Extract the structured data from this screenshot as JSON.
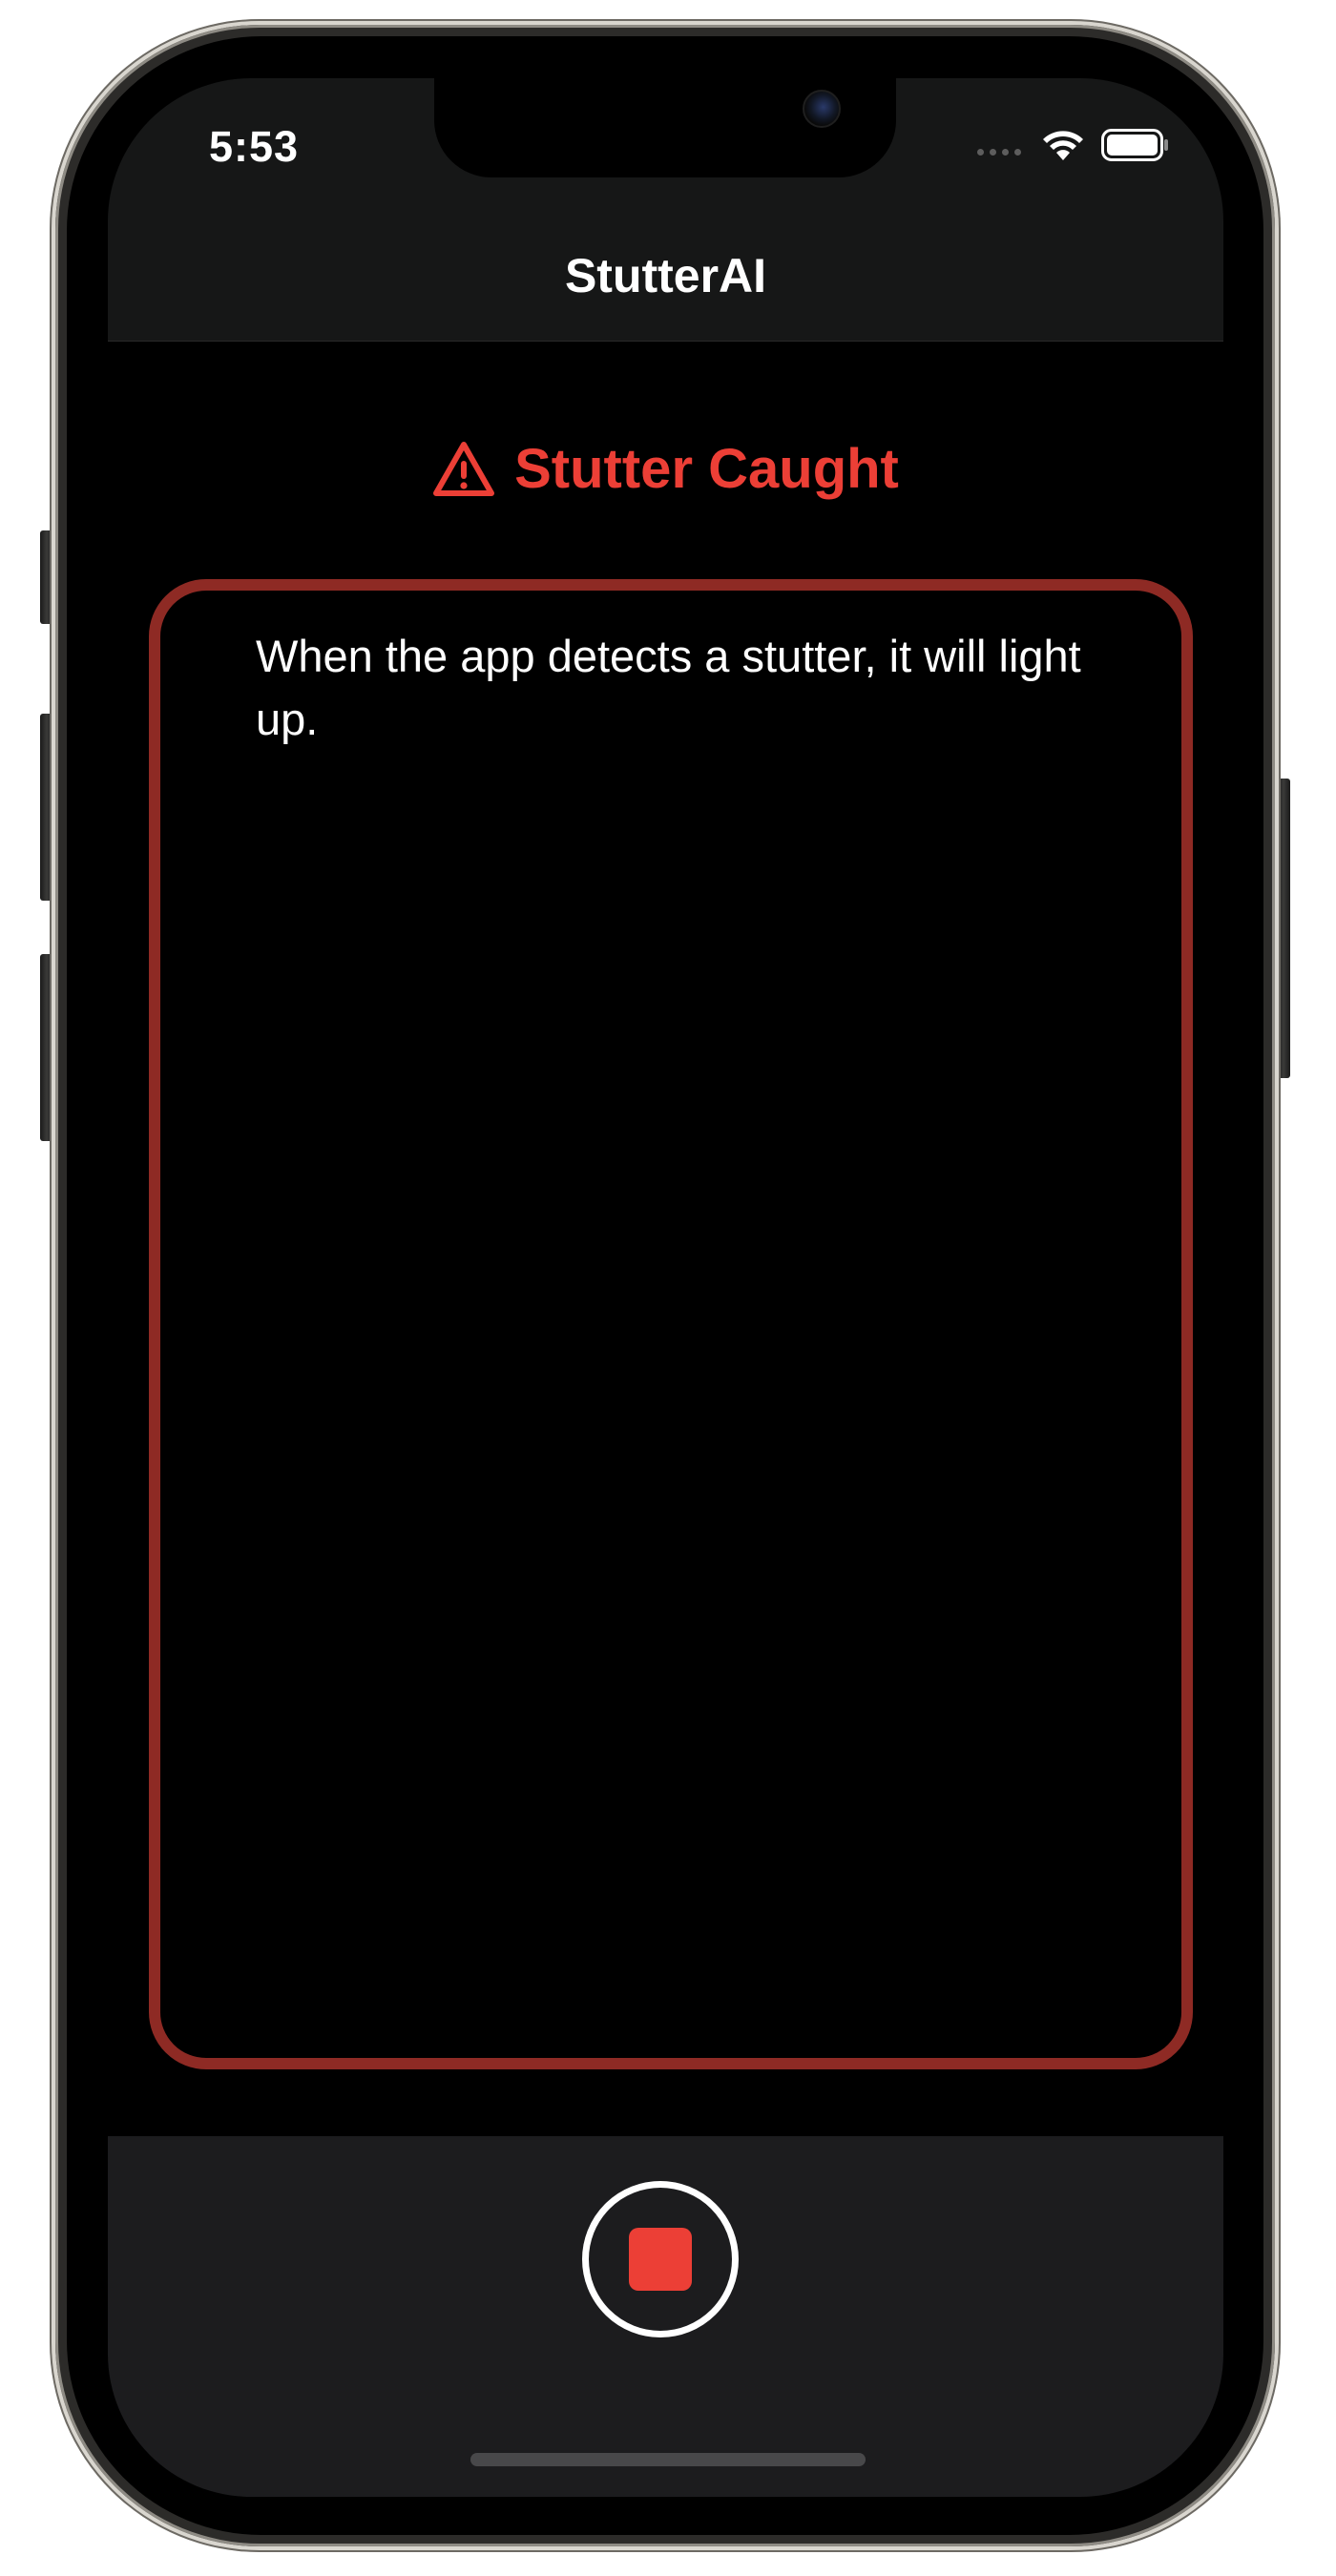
{
  "status_bar": {
    "time": "5:53",
    "icons": [
      "cellular-dots-icon",
      "wifi-icon",
      "battery-icon"
    ]
  },
  "nav": {
    "title": "StutterAI"
  },
  "alert": {
    "icon": "warning-triangle-icon",
    "label": "Stutter Caught",
    "color": "#ec3f36"
  },
  "detection_panel": {
    "message": "When the app detects a stutter, it will light up.",
    "border_color": "#8e2a24"
  },
  "toolbar": {
    "record_button_icon": "stop-icon",
    "stop_color": "#ec3f36"
  },
  "colors": {
    "background": "#000000",
    "bar_background": "#1c1c1e",
    "accent_red": "#ec3f36"
  }
}
